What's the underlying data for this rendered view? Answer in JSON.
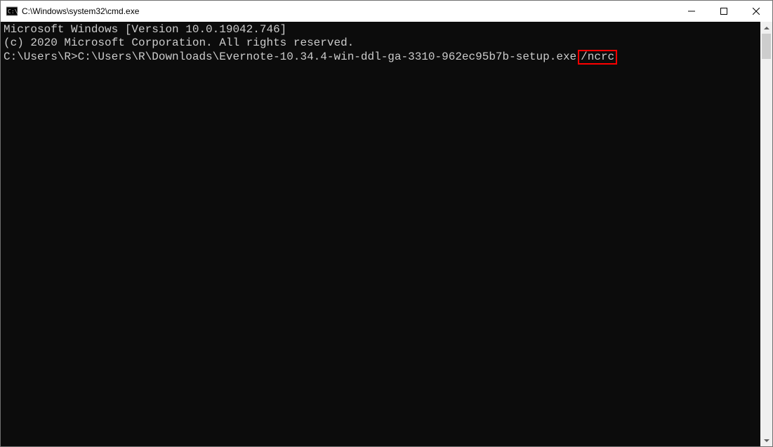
{
  "window": {
    "title": "C:\\Windows\\system32\\cmd.exe"
  },
  "terminal": {
    "line1": "Microsoft Windows [Version 10.0.19042.746]",
    "line2": "(c) 2020 Microsoft Corporation. All rights reserved.",
    "blank": "",
    "prompt": "C:\\Users\\R>",
    "command": "C:\\Users\\R\\Downloads\\Evernote-10.34.4-win-ddl-ga-3310-962ec95b7b-setup.exe",
    "flag": "/ncrc"
  }
}
